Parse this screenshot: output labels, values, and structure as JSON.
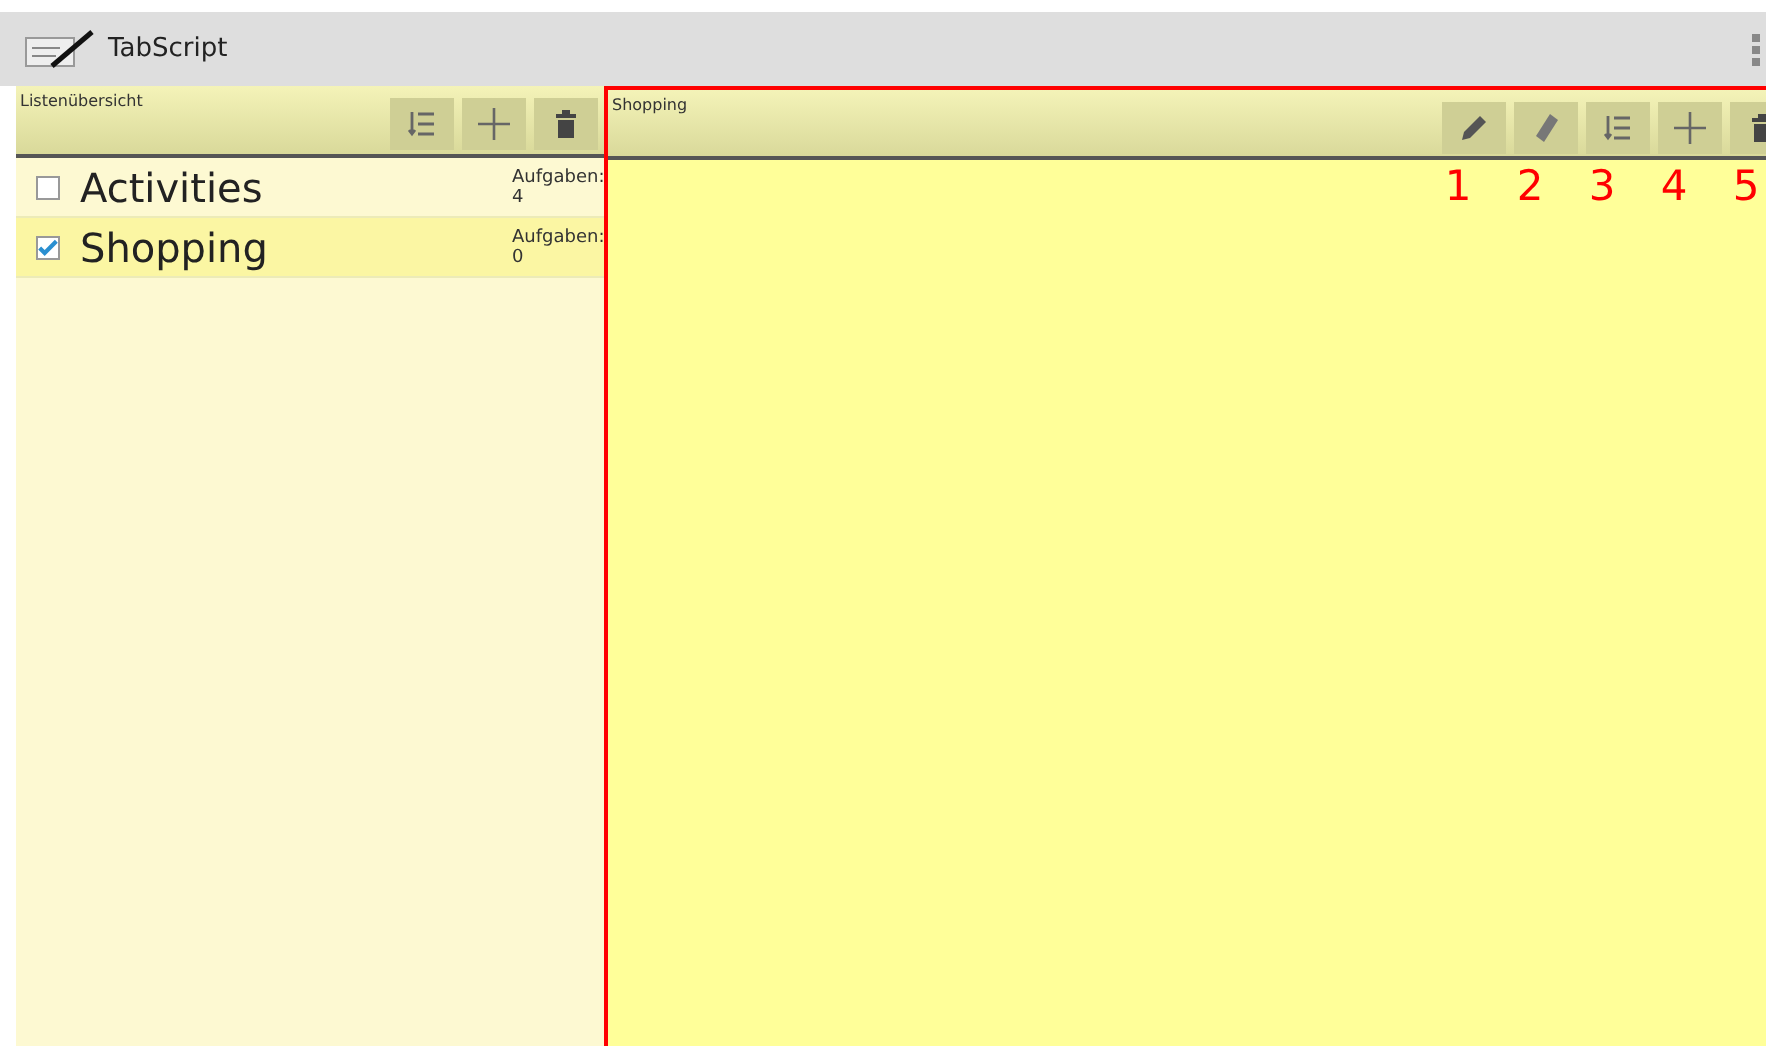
{
  "app_bar": {
    "title": "TabScript"
  },
  "lists_panel": {
    "title": "Listenübersicht",
    "toolbar": [
      {
        "kind": "sort"
      },
      {
        "kind": "add"
      },
      {
        "kind": "delete"
      }
    ],
    "items": [
      {
        "name": "Activities",
        "checked": false,
        "selected": false,
        "count_label": "Aufgaben:",
        "count": "4"
      },
      {
        "name": "Shopping",
        "checked": true,
        "selected": true,
        "count_label": "Aufgaben:",
        "count": "0"
      }
    ]
  },
  "detail_panel": {
    "title": "Shopping",
    "toolbar": [
      {
        "kind": "edit",
        "annotation": "1"
      },
      {
        "kind": "tag",
        "annotation": "2"
      },
      {
        "kind": "sort",
        "annotation": "3"
      },
      {
        "kind": "add",
        "annotation": "4"
      },
      {
        "kind": "delete",
        "annotation": "5"
      }
    ]
  }
}
